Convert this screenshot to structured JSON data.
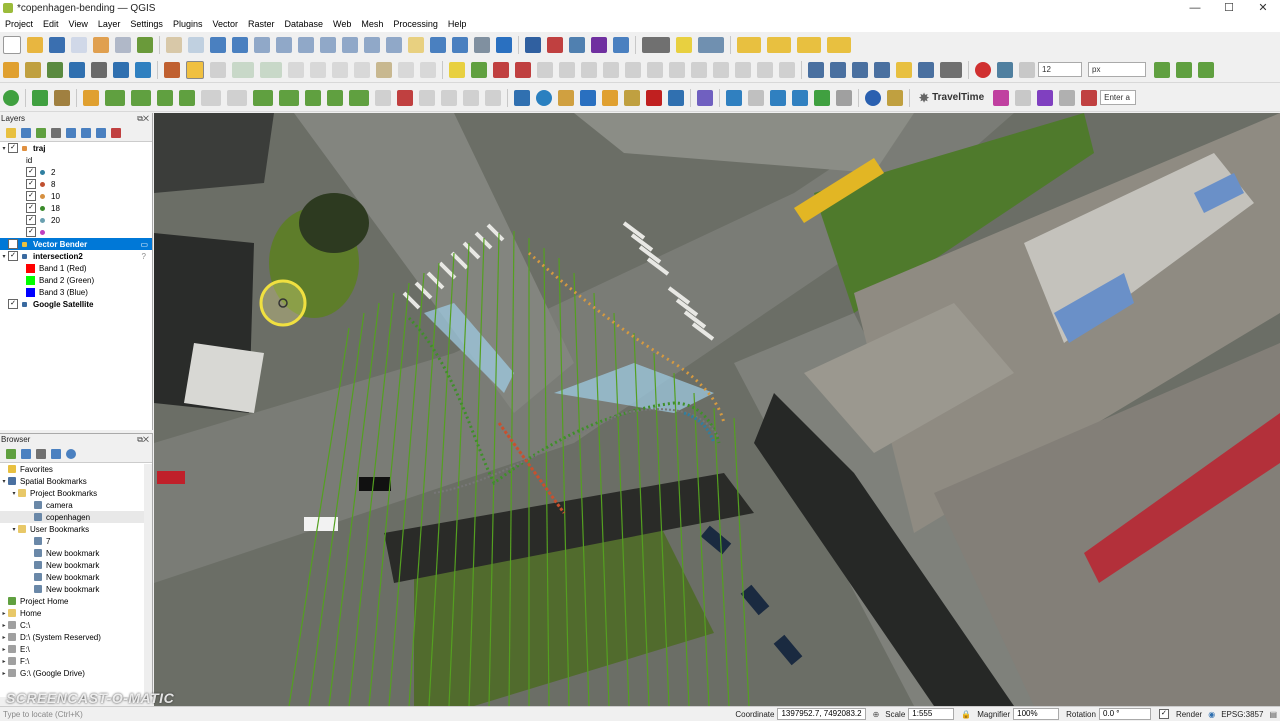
{
  "window": {
    "title": "*copenhagen-bending — QGIS",
    "controls": [
      "—",
      "☐",
      "✕"
    ]
  },
  "menu": [
    "Project",
    "Edit",
    "View",
    "Layer",
    "Settings",
    "Plugins",
    "Vector",
    "Raster",
    "Database",
    "Web",
    "Mesh",
    "Processing",
    "Help"
  ],
  "toolbar": {
    "font_size_value": "12",
    "font_unit": "px",
    "traveltime_label": "TravelTime",
    "search_placeholder": "Enter a"
  },
  "layers_panel": {
    "title": "Layers",
    "items": [
      {
        "label": "traj",
        "bold": true,
        "checked": true
      },
      {
        "label": "id"
      },
      {
        "label": "2",
        "color": "#2f7fa0",
        "checked": true
      },
      {
        "label": "8",
        "color": "#c05030",
        "checked": true
      },
      {
        "label": "10",
        "color": "#d69040",
        "checked": true
      },
      {
        "label": "18",
        "color": "#3a8a2a",
        "checked": true
      },
      {
        "label": "20",
        "color": "#6aa0b0",
        "checked": true
      },
      {
        "label": "",
        "color": "#c040c0",
        "checked": true
      },
      {
        "label": "Vector Bender",
        "bold": true,
        "checked": true,
        "selected": true
      },
      {
        "label": "intersection2",
        "bold": true,
        "checked": true
      },
      {
        "label": "Band 1 (Red)",
        "color": "#ff0000"
      },
      {
        "label": "Band 2 (Green)",
        "color": "#00ff00"
      },
      {
        "label": "Band 3 (Blue)",
        "color": "#0000ff"
      },
      {
        "label": "Google Satellite",
        "bold": true,
        "checked": true
      }
    ]
  },
  "browser_panel": {
    "title": "Browser",
    "items": [
      {
        "label": "Favorites",
        "indent": 0
      },
      {
        "label": "Spatial Bookmarks",
        "indent": 0
      },
      {
        "label": "Project Bookmarks",
        "indent": 1
      },
      {
        "label": "camera",
        "indent": 2
      },
      {
        "label": "copenhagen",
        "indent": 2
      },
      {
        "label": "User Bookmarks",
        "indent": 1
      },
      {
        "label": "7",
        "indent": 2
      },
      {
        "label": "New bookmark",
        "indent": 2
      },
      {
        "label": "New bookmark",
        "indent": 2
      },
      {
        "label": "New bookmark",
        "indent": 2
      },
      {
        "label": "New bookmark",
        "indent": 2
      },
      {
        "label": "Project Home",
        "indent": 0
      },
      {
        "label": "Home",
        "indent": 0
      },
      {
        "label": "C:\\",
        "indent": 0
      },
      {
        "label": "D:\\ (System Reserved)",
        "indent": 0
      },
      {
        "label": "E:\\",
        "indent": 0
      },
      {
        "label": "F:\\",
        "indent": 0
      },
      {
        "label": "G:\\ (Google Drive)",
        "indent": 0
      }
    ]
  },
  "status": {
    "locator_placeholder": "Type to locate (Ctrl+K)",
    "coordinate_label": "Coordinate",
    "coordinate_value": "1397952.7, 7492083.2",
    "scale_label": "Scale",
    "scale_value": "1:555",
    "magnifier_label": "Magnifier",
    "magnifier_value": "100%",
    "rotation_label": "Rotation",
    "rotation_value": "0.0 °",
    "render_label": "Render",
    "crs": "EPSG:3857"
  },
  "watermark": "SCREENCAST-O-MATIC"
}
